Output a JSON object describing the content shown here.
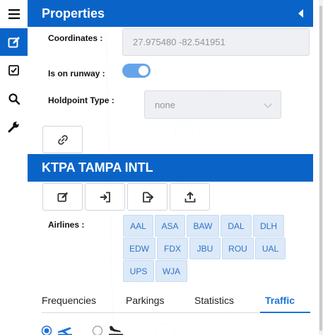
{
  "properties": {
    "title": "Properties",
    "coordinates_label": "Coordinates :",
    "coordinates_value": "27.975480 -82.541951",
    "on_runway_label": "Is on runway :",
    "on_runway": true,
    "holdpoint_label": "Holdpoint Type :",
    "holdpoint_value": "none"
  },
  "airport": {
    "title": "KTPA TAMPA INTL",
    "airlines_label": "Airlines :",
    "airlines": [
      "AAL",
      "ASA",
      "BAW",
      "DAL",
      "DLH",
      "EDW",
      "FDX",
      "JBU",
      "ROU",
      "UAL",
      "UPS",
      "WJA"
    ]
  },
  "tabs": [
    {
      "label": "Frequencies",
      "active": false
    },
    {
      "label": "Parkings",
      "active": false
    },
    {
      "label": "Statistics",
      "active": false
    },
    {
      "label": "Traffic",
      "active": true
    }
  ],
  "icons": {
    "menu": "hamburger-icon",
    "edit": "edit-icon",
    "check": "checkbox-icon",
    "search": "search-icon",
    "wrench": "wrench-icon"
  },
  "colors": {
    "accent": "#0a64c8",
    "airline_text": "#2f73c7",
    "tab_active": "#1a73d9"
  }
}
